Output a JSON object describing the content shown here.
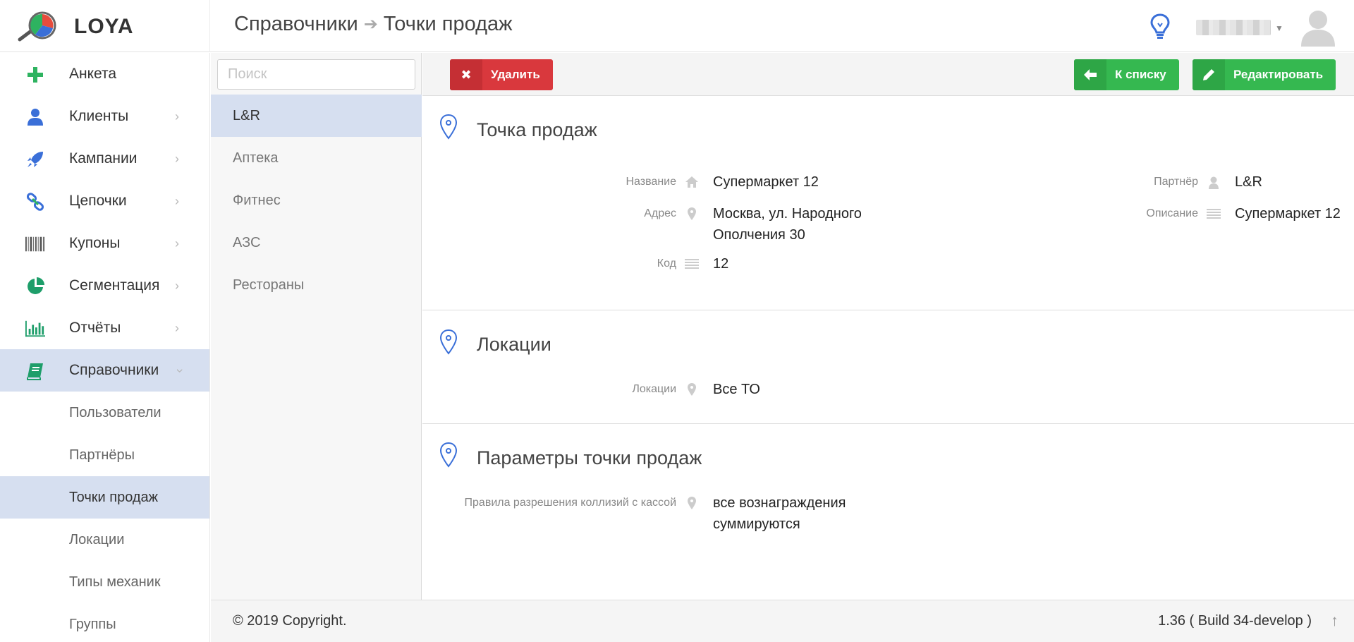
{
  "header": {
    "brand": "LOYA",
    "breadcrumb": [
      "Справочники",
      "Точки продаж"
    ],
    "breadcrumb_separator": "➔"
  },
  "sidebar": {
    "items": [
      {
        "label": "Анкета",
        "icon": "plus-icon"
      },
      {
        "label": "Клиенты",
        "icon": "user-icon"
      },
      {
        "label": "Кампании",
        "icon": "rocket-icon"
      },
      {
        "label": "Цепочки",
        "icon": "link-icon"
      },
      {
        "label": "Купоны",
        "icon": "barcode-icon"
      },
      {
        "label": "Сегментация",
        "icon": "pie-icon"
      },
      {
        "label": "Отчёты",
        "icon": "bar-chart-icon"
      },
      {
        "label": "Справочники",
        "icon": "book-icon"
      }
    ],
    "subitems": [
      "Пользователи",
      "Партнёры",
      "Точки продаж",
      "Локации",
      "Типы механик",
      "Группы"
    ]
  },
  "list": {
    "search_placeholder": "Поиск",
    "items": [
      "L&R",
      "Аптека",
      "Фитнес",
      "АЗС",
      "Рестораны"
    ]
  },
  "toolbar": {
    "delete_label": "Удалить",
    "back_label": "К списку",
    "edit_label": "Редактировать"
  },
  "sections": {
    "point": {
      "title": "Точка продаж",
      "name_label": "Название",
      "name_value": "Супермаркет 12",
      "address_label": "Адрес",
      "address_line1": "Москва, ул. Народного",
      "address_line2": "Ополчения 30",
      "code_label": "Код",
      "code_value": "12",
      "partner_label": "Партнёр",
      "partner_value": "L&R",
      "description_label": "Описание",
      "description_value": "Супермаркет 12"
    },
    "locations": {
      "title": "Локации",
      "label": "Локации",
      "value": "Все ТО"
    },
    "params": {
      "title": "Параметры точки продаж",
      "label": "Правила разрешения коллизий с кассой",
      "value_line1": "все вознаграждения",
      "value_line2": "суммируются"
    }
  },
  "footer": {
    "copyright": "© 2019 Copyright.",
    "build": "1.36 ( Build 34-develop )"
  },
  "colors": {
    "accent_blue": "#3a6fd8",
    "active_bg": "#d6dff0",
    "danger": "#d9383d",
    "success": "#35b850"
  }
}
